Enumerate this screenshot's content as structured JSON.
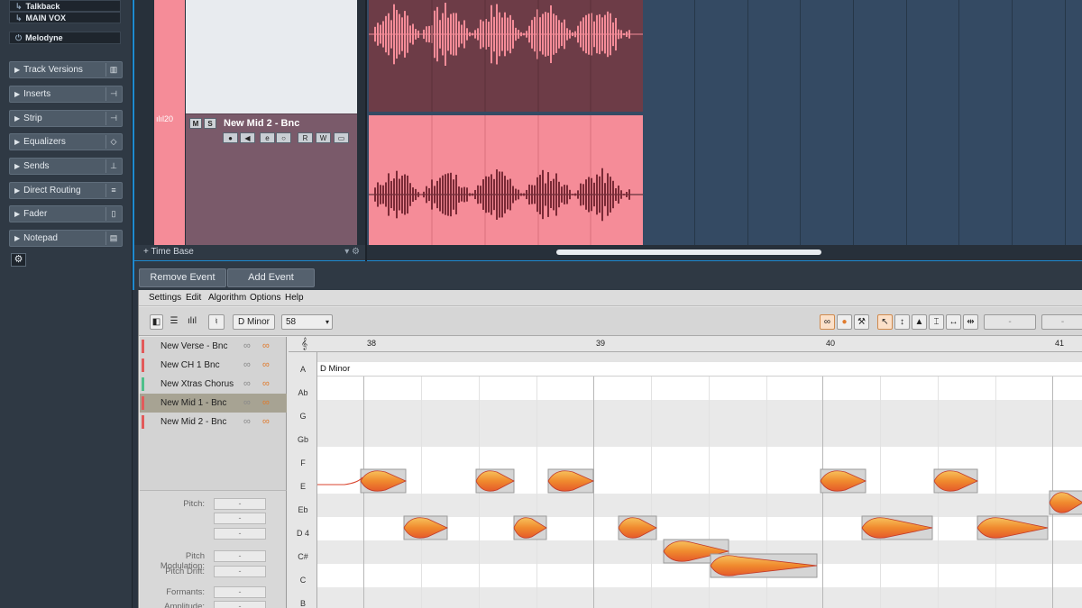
{
  "inspector": {
    "track_items": [
      "Talkback",
      "MAIN VOX"
    ],
    "plugin": "Melodyne",
    "sections": [
      {
        "label": "Track Versions",
        "icon": "track-versions-icon"
      },
      {
        "label": "Inserts",
        "icon": "inserts-icon"
      },
      {
        "label": "Strip",
        "icon": "strip-icon"
      },
      {
        "label": "Equalizers",
        "icon": "eq-icon"
      },
      {
        "label": "Sends",
        "icon": "sends-icon"
      },
      {
        "label": "Direct Routing",
        "icon": "routing-icon"
      },
      {
        "label": "Fader",
        "icon": "fader-icon"
      },
      {
        "label": "Notepad",
        "icon": "notepad-icon"
      }
    ]
  },
  "project": {
    "track_name": "New Mid 2 - Bnc",
    "track_number": "20",
    "mute_label": "M",
    "solo_label": "S",
    "read_label": "R",
    "write_label": "W",
    "timebase_label": "+ Time Base"
  },
  "melodyne": {
    "tabs": [
      "Remove Event",
      "Add Event"
    ],
    "menu": [
      "Settings",
      "Edit",
      "Algorithm",
      "Options",
      "Help"
    ],
    "key_value": "D Minor",
    "tempo_value": "58",
    "placeholder_value": "-",
    "blobs": [
      {
        "name": "New Verse - Bnc",
        "color": "#e25a5a"
      },
      {
        "name": "New CH  1 Bnc",
        "color": "#e25a5a"
      },
      {
        "name": "New Xtras Chorus",
        "color": "#4fbf8a"
      },
      {
        "name": "New Mid 1 - Bnc",
        "color": "#e25a5a"
      },
      {
        "name": "New Mid 2 - Bnc",
        "color": "#e25a5a"
      }
    ],
    "params": [
      "Pitch:",
      "",
      "",
      "Pitch Modulation:",
      "Pitch Drift:",
      "Formants:",
      "Amplitude:"
    ],
    "param_value": "-",
    "bars": [
      "38",
      "39",
      "40",
      "41"
    ],
    "scale_label": "D Minor",
    "pitch_labels": [
      "A",
      "Ab",
      "G",
      "Gb",
      "F",
      "E",
      "Eb",
      "D 4",
      "C#",
      "C",
      "B"
    ]
  },
  "colors": {
    "accent": "#1e8ad0",
    "clip_pink": "#f58c98",
    "clip_dark": "#6d3c47",
    "note_orange": "#f0882e"
  }
}
